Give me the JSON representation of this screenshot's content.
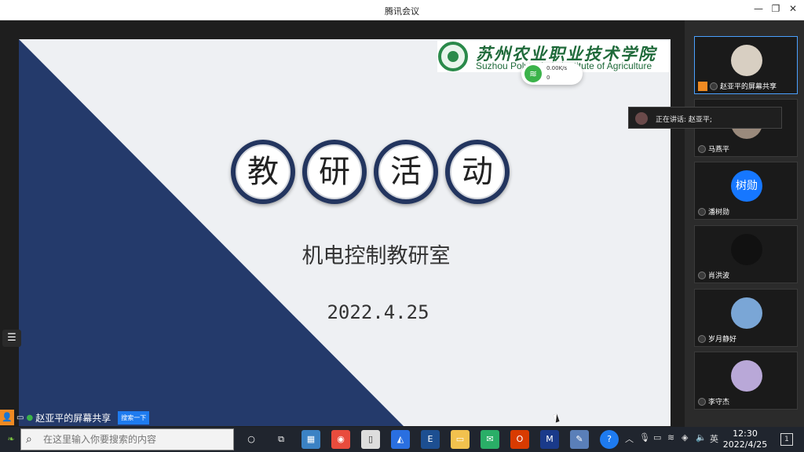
{
  "window": {
    "title": "腾讯会议"
  },
  "slide": {
    "logo_cn": "苏州农业职业技术学院",
    "logo_en": "Suzhou Polytechnic Institute of Agriculture",
    "circles": [
      "教",
      "研",
      "活",
      "动"
    ],
    "subtitle": "机电控制教研室",
    "date": "2022.4.25",
    "navy": "#243a6b"
  },
  "network": {
    "speed": "0.00K/s",
    "count": "0"
  },
  "speaking": {
    "label": "正在讲话: 赵亚平;"
  },
  "participants": [
    {
      "name": "赵亚平的屏幕共享",
      "avatar_text": "",
      "avatar_color": "#d8cfc2"
    },
    {
      "name": "马燕平",
      "avatar_text": "",
      "avatar_color": "#9a8a7c"
    },
    {
      "name": "潘树勋",
      "avatar_text": "树勋",
      "avatar_color": "#1677ff"
    },
    {
      "name": "肖洪波",
      "avatar_text": "",
      "avatar_color": "#111111"
    },
    {
      "name": "岁月静好",
      "avatar_text": "",
      "avatar_color": "#7aa6d6"
    },
    {
      "name": "李守杰",
      "avatar_text": "",
      "avatar_color": "#b9a8d8"
    }
  ],
  "share_bar": {
    "label": "赵亚平的屏幕共享",
    "button": "搜索一下"
  },
  "taskbar": {
    "search_placeholder": "在这里输入你要搜索的内容",
    "ime": "英",
    "time": "12:30",
    "date": "2022/4/25",
    "notif_count": "1"
  }
}
